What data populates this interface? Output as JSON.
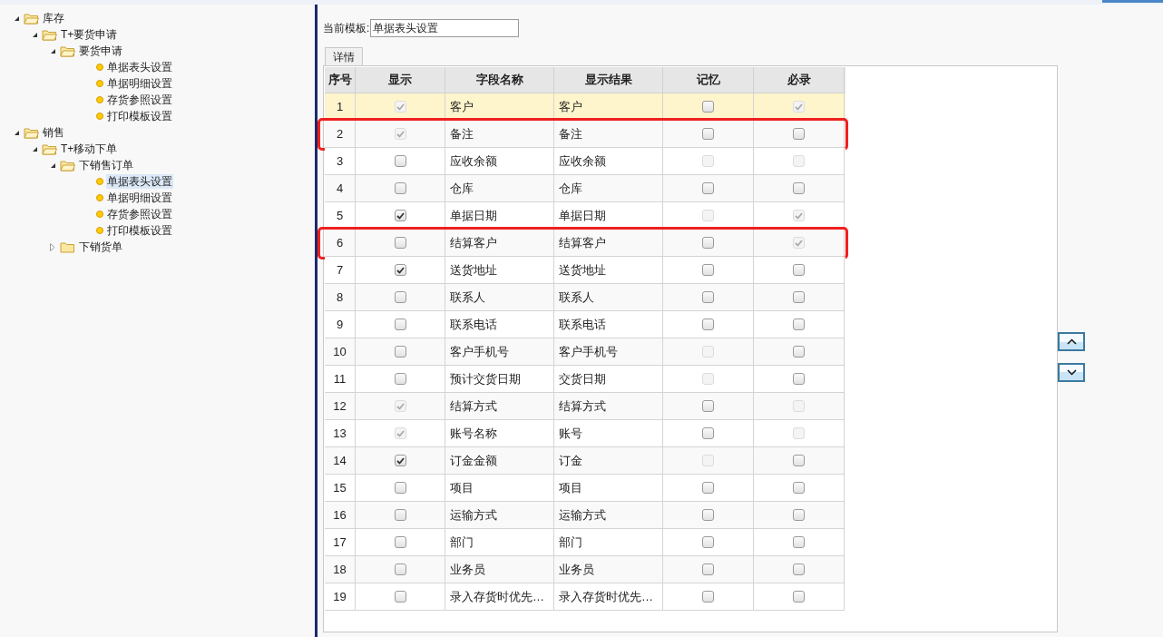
{
  "tree": [
    {
      "label": "库存",
      "kind": "folder",
      "expanded": true,
      "selected": false,
      "children": [
        {
          "label": "T+要货申请",
          "kind": "folder",
          "expanded": true,
          "selected": false,
          "children": [
            {
              "label": "要货申请",
              "kind": "folder",
              "expanded": true,
              "selected": false,
              "children": [
                {
                  "label": "单据表头设置",
                  "kind": "item",
                  "selected": false
                },
                {
                  "label": "单据明细设置",
                  "kind": "item",
                  "selected": false
                },
                {
                  "label": "存货参照设置",
                  "kind": "item",
                  "selected": false
                },
                {
                  "label": "打印模板设置",
                  "kind": "item",
                  "selected": false
                }
              ]
            }
          ]
        }
      ]
    },
    {
      "label": "销售",
      "kind": "folder",
      "expanded": true,
      "selected": false,
      "children": [
        {
          "label": "T+移动下单",
          "kind": "folder",
          "expanded": true,
          "selected": false,
          "children": [
            {
              "label": "下销售订单",
              "kind": "folder",
              "expanded": true,
              "selected": false,
              "children": [
                {
                  "label": "单据表头设置",
                  "kind": "item",
                  "selected": true
                },
                {
                  "label": "单据明细设置",
                  "kind": "item",
                  "selected": false
                },
                {
                  "label": "存货参照设置",
                  "kind": "item",
                  "selected": false
                },
                {
                  "label": "打印模板设置",
                  "kind": "item",
                  "selected": false
                }
              ]
            },
            {
              "label": "下销货单",
              "kind": "folder",
              "expanded": false,
              "selected": false
            }
          ]
        }
      ]
    }
  ],
  "template": {
    "label": "当前模板:",
    "value": "单据表头设置"
  },
  "tabs": [
    {
      "label": "详情",
      "selected": true
    }
  ],
  "table": {
    "columns": [
      "序号",
      "显示",
      "字段名称",
      "显示结果",
      "记忆",
      "必录"
    ],
    "rows": [
      {
        "no": "1",
        "show": {
          "checked": true,
          "disabled": true
        },
        "field": "客户",
        "result": "客户",
        "memory": {
          "checked": false,
          "disabled": false
        },
        "required": {
          "checked": true,
          "disabled": true
        },
        "selected": true,
        "highlighted": false
      },
      {
        "no": "2",
        "show": {
          "checked": true,
          "disabled": true
        },
        "field": "备注",
        "result": "备注",
        "memory": {
          "checked": false,
          "disabled": false
        },
        "required": {
          "checked": false,
          "disabled": false
        },
        "selected": false,
        "highlighted": true
      },
      {
        "no": "3",
        "show": {
          "checked": false,
          "disabled": false
        },
        "field": "应收余额",
        "result": "应收余额",
        "memory": {
          "checked": false,
          "disabled": true
        },
        "required": {
          "checked": false,
          "disabled": true
        },
        "selected": false,
        "highlighted": false
      },
      {
        "no": "4",
        "show": {
          "checked": false,
          "disabled": false
        },
        "field": "仓库",
        "result": "仓库",
        "memory": {
          "checked": false,
          "disabled": false
        },
        "required": {
          "checked": false,
          "disabled": false
        },
        "selected": false,
        "highlighted": false
      },
      {
        "no": "5",
        "show": {
          "checked": true,
          "disabled": false
        },
        "field": "单据日期",
        "result": "单据日期",
        "memory": {
          "checked": false,
          "disabled": true
        },
        "required": {
          "checked": true,
          "disabled": true
        },
        "selected": false,
        "highlighted": false
      },
      {
        "no": "6",
        "show": {
          "checked": false,
          "disabled": false
        },
        "field": "结算客户",
        "result": "结算客户",
        "memory": {
          "checked": false,
          "disabled": false
        },
        "required": {
          "checked": true,
          "disabled": true
        },
        "selected": false,
        "highlighted": true
      },
      {
        "no": "7",
        "show": {
          "checked": true,
          "disabled": false
        },
        "field": "送货地址",
        "result": "送货地址",
        "memory": {
          "checked": false,
          "disabled": false
        },
        "required": {
          "checked": false,
          "disabled": false
        },
        "selected": false,
        "highlighted": false
      },
      {
        "no": "8",
        "show": {
          "checked": false,
          "disabled": false
        },
        "field": "联系人",
        "result": "联系人",
        "memory": {
          "checked": false,
          "disabled": false
        },
        "required": {
          "checked": false,
          "disabled": false
        },
        "selected": false,
        "highlighted": false
      },
      {
        "no": "9",
        "show": {
          "checked": false,
          "disabled": false
        },
        "field": "联系电话",
        "result": "联系电话",
        "memory": {
          "checked": false,
          "disabled": false
        },
        "required": {
          "checked": false,
          "disabled": false
        },
        "selected": false,
        "highlighted": false
      },
      {
        "no": "10",
        "show": {
          "checked": false,
          "disabled": false
        },
        "field": "客户手机号",
        "result": "客户手机号",
        "memory": {
          "checked": false,
          "disabled": true
        },
        "required": {
          "checked": false,
          "disabled": false
        },
        "selected": false,
        "highlighted": false
      },
      {
        "no": "11",
        "show": {
          "checked": false,
          "disabled": false
        },
        "field": "预计交货日期",
        "result": "交货日期",
        "memory": {
          "checked": false,
          "disabled": true
        },
        "required": {
          "checked": false,
          "disabled": false
        },
        "selected": false,
        "highlighted": false
      },
      {
        "no": "12",
        "show": {
          "checked": true,
          "disabled": true
        },
        "field": "结算方式",
        "result": "结算方式",
        "memory": {
          "checked": false,
          "disabled": false
        },
        "required": {
          "checked": false,
          "disabled": true
        },
        "selected": false,
        "highlighted": false
      },
      {
        "no": "13",
        "show": {
          "checked": true,
          "disabled": true
        },
        "field": "账号名称",
        "result": "账号",
        "memory": {
          "checked": false,
          "disabled": false
        },
        "required": {
          "checked": false,
          "disabled": true
        },
        "selected": false,
        "highlighted": false
      },
      {
        "no": "14",
        "show": {
          "checked": true,
          "disabled": false
        },
        "field": "订金金额",
        "result": "订金",
        "memory": {
          "checked": false,
          "disabled": true
        },
        "required": {
          "checked": false,
          "disabled": false
        },
        "selected": false,
        "highlighted": false
      },
      {
        "no": "15",
        "show": {
          "checked": false,
          "disabled": false
        },
        "field": "项目",
        "result": "项目",
        "memory": {
          "checked": false,
          "disabled": false
        },
        "required": {
          "checked": false,
          "disabled": false
        },
        "selected": false,
        "highlighted": false
      },
      {
        "no": "16",
        "show": {
          "checked": false,
          "disabled": false
        },
        "field": "运输方式",
        "result": "运输方式",
        "memory": {
          "checked": false,
          "disabled": false
        },
        "required": {
          "checked": false,
          "disabled": false
        },
        "selected": false,
        "highlighted": false
      },
      {
        "no": "17",
        "show": {
          "checked": false,
          "disabled": false
        },
        "field": "部门",
        "result": "部门",
        "memory": {
          "checked": false,
          "disabled": false
        },
        "required": {
          "checked": false,
          "disabled": false
        },
        "selected": false,
        "highlighted": false
      },
      {
        "no": "18",
        "show": {
          "checked": false,
          "disabled": false
        },
        "field": "业务员",
        "result": "业务员",
        "memory": {
          "checked": false,
          "disabled": false
        },
        "required": {
          "checked": false,
          "disabled": false
        },
        "selected": false,
        "highlighted": false
      },
      {
        "no": "19",
        "show": {
          "checked": false,
          "disabled": false
        },
        "field": "录入存货时优先…",
        "result": "录入存货时优先…",
        "memory": {
          "checked": false,
          "disabled": false
        },
        "required": {
          "checked": false,
          "disabled": false
        },
        "selected": false,
        "highlighted": false
      }
    ]
  }
}
